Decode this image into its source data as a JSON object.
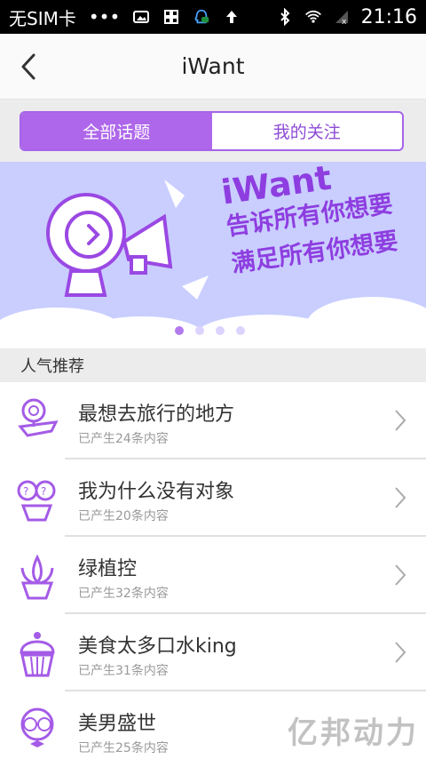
{
  "status_bar": {
    "carrier": "无SIM卡",
    "dots": "•••",
    "time": "21:16"
  },
  "header": {
    "title": "iWant"
  },
  "tabs": [
    {
      "label": "全部话题",
      "active": true
    },
    {
      "label": "我的关注",
      "active": false
    }
  ],
  "banner": {
    "line1": "iWant",
    "line2": "告诉所有你想要",
    "line3": "满足所有你想要",
    "dots": 4,
    "active_dot": 0
  },
  "section": {
    "label": "人气推荐"
  },
  "topics": [
    {
      "title": "最想去旅行的地方",
      "meta": "已产生24条内容",
      "icon": "airplane-icon"
    },
    {
      "title": "我为什么没有对象",
      "meta": "已产生20条内容",
      "icon": "question-person-icon"
    },
    {
      "title": "绿植控",
      "meta": "已产生32条内容",
      "icon": "plant-icon"
    },
    {
      "title": "美食太多口水king",
      "meta": "已产生31条内容",
      "icon": "cupcake-icon"
    },
    {
      "title": "美男盛世",
      "meta": "已产生25条内容",
      "icon": "glasses-man-icon"
    }
  ],
  "watermark": "亿邦动力",
  "colors": {
    "accent": "#ae67ea",
    "banner_bg": "#c9ceff",
    "status_bg": "#000000"
  }
}
